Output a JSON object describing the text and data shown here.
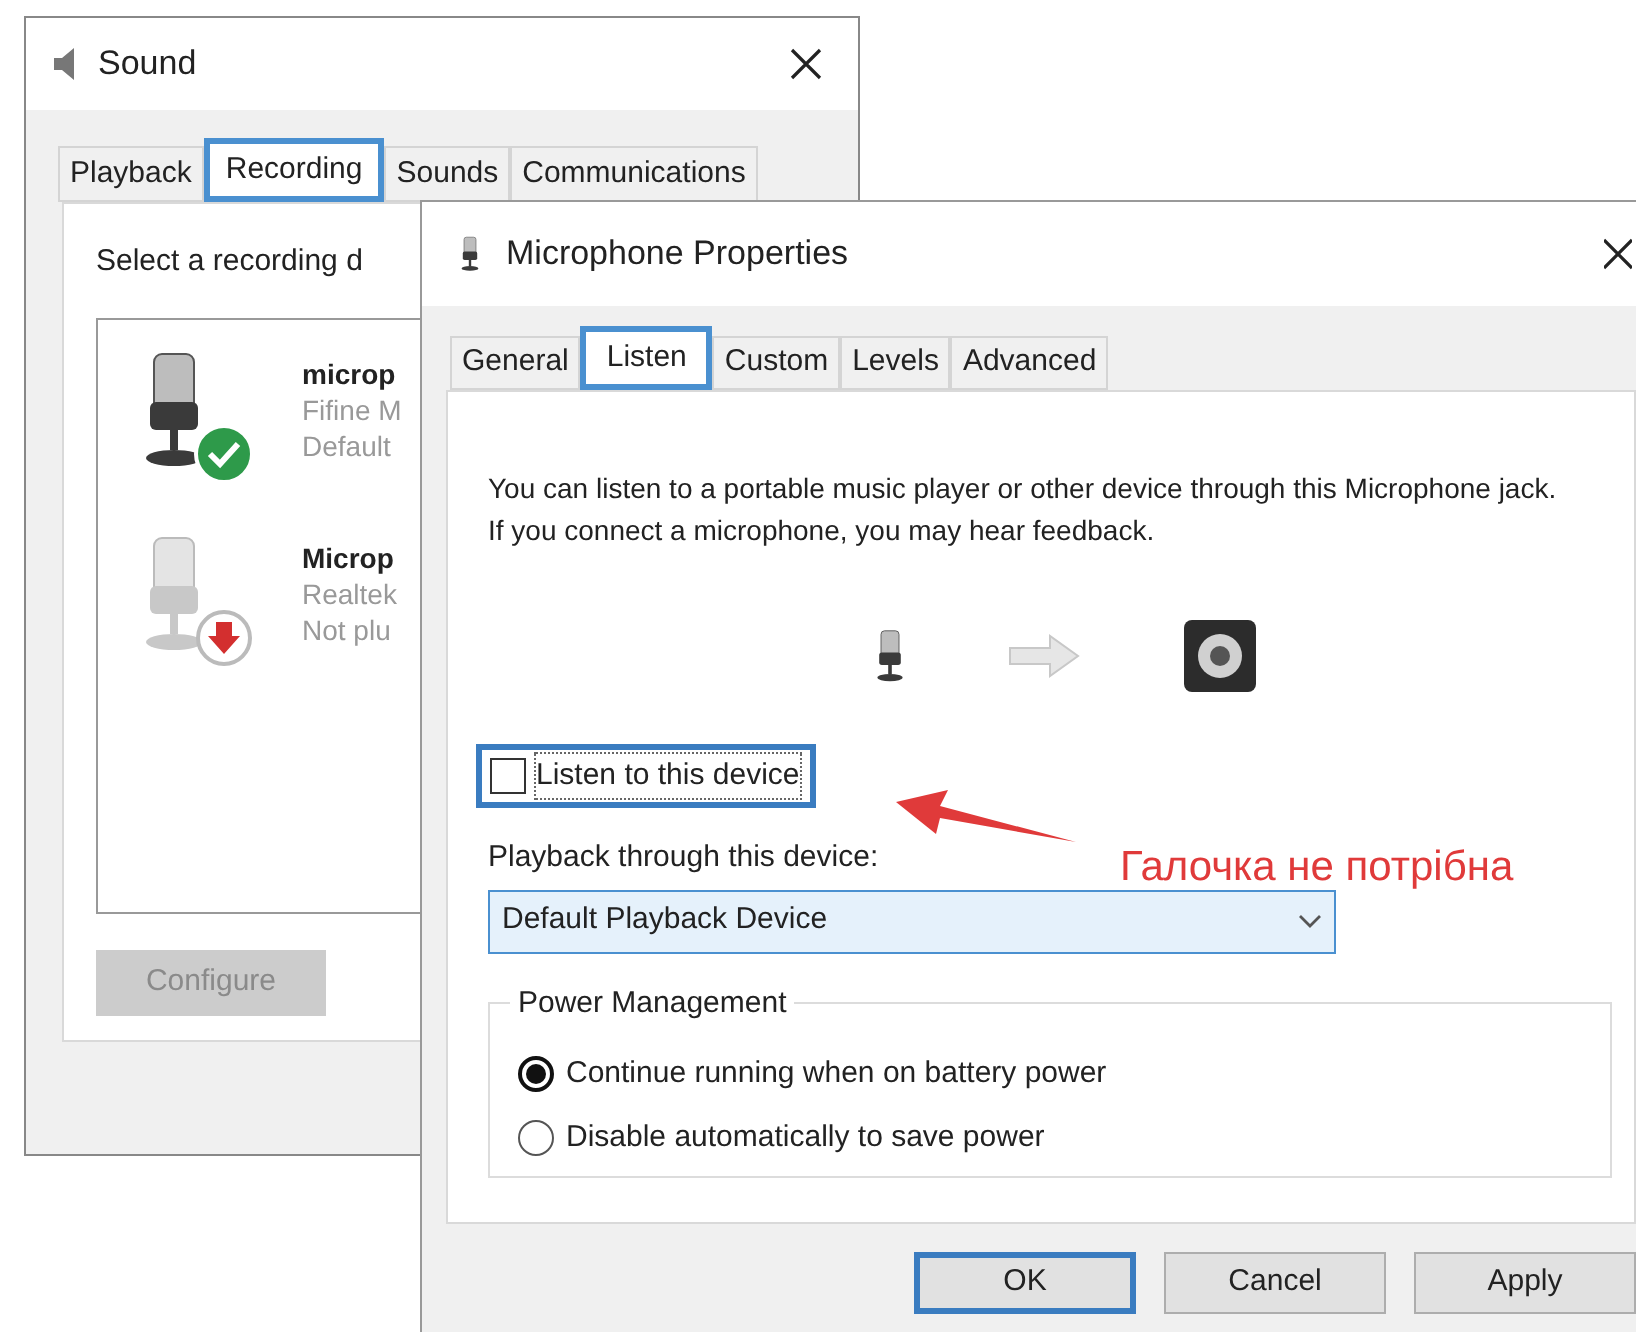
{
  "sound_window": {
    "title": "Sound",
    "tabs": [
      {
        "label": "Playback",
        "selected": false
      },
      {
        "label": "Recording",
        "selected": true
      },
      {
        "label": "Sounds",
        "selected": false
      },
      {
        "label": "Communications",
        "selected": false
      }
    ],
    "instruction": "Select a recording d",
    "devices": [
      {
        "name": "microp",
        "driver": "Fifine M",
        "status": "Default",
        "kind": "default"
      },
      {
        "name": "Microp",
        "driver": "Realtek",
        "status": "Not plu",
        "kind": "unplugged"
      }
    ],
    "configure_button": {
      "label": "Configure",
      "disabled": true
    }
  },
  "properties_dialog": {
    "title": "Microphone Properties",
    "tabs": [
      {
        "label": "General",
        "selected": false
      },
      {
        "label": "Listen",
        "selected": true
      },
      {
        "label": "Custom",
        "selected": false
      },
      {
        "label": "Levels",
        "selected": false
      },
      {
        "label": "Advanced",
        "selected": false
      }
    ],
    "description": "You can listen to a portable music player or other device through this Microphone jack.  If you connect a microphone, you may hear feedback.",
    "listen_checkbox": {
      "label": "Listen to this device",
      "checked": false,
      "highlighted": true
    },
    "playback_label": "Playback through this device:",
    "playback_device": {
      "value": "Default Playback Device"
    },
    "power_management": {
      "title": "Power Management",
      "options": [
        {
          "label": "Continue running when on battery power",
          "selected": true
        },
        {
          "label": "Disable automatically to save power",
          "selected": false
        }
      ]
    },
    "buttons": [
      {
        "label": "OK",
        "default": true
      },
      {
        "label": "Cancel",
        "default": false
      },
      {
        "label": "Apply",
        "default": false
      }
    ]
  },
  "annotation": {
    "text": "Галочка не потрібна"
  }
}
